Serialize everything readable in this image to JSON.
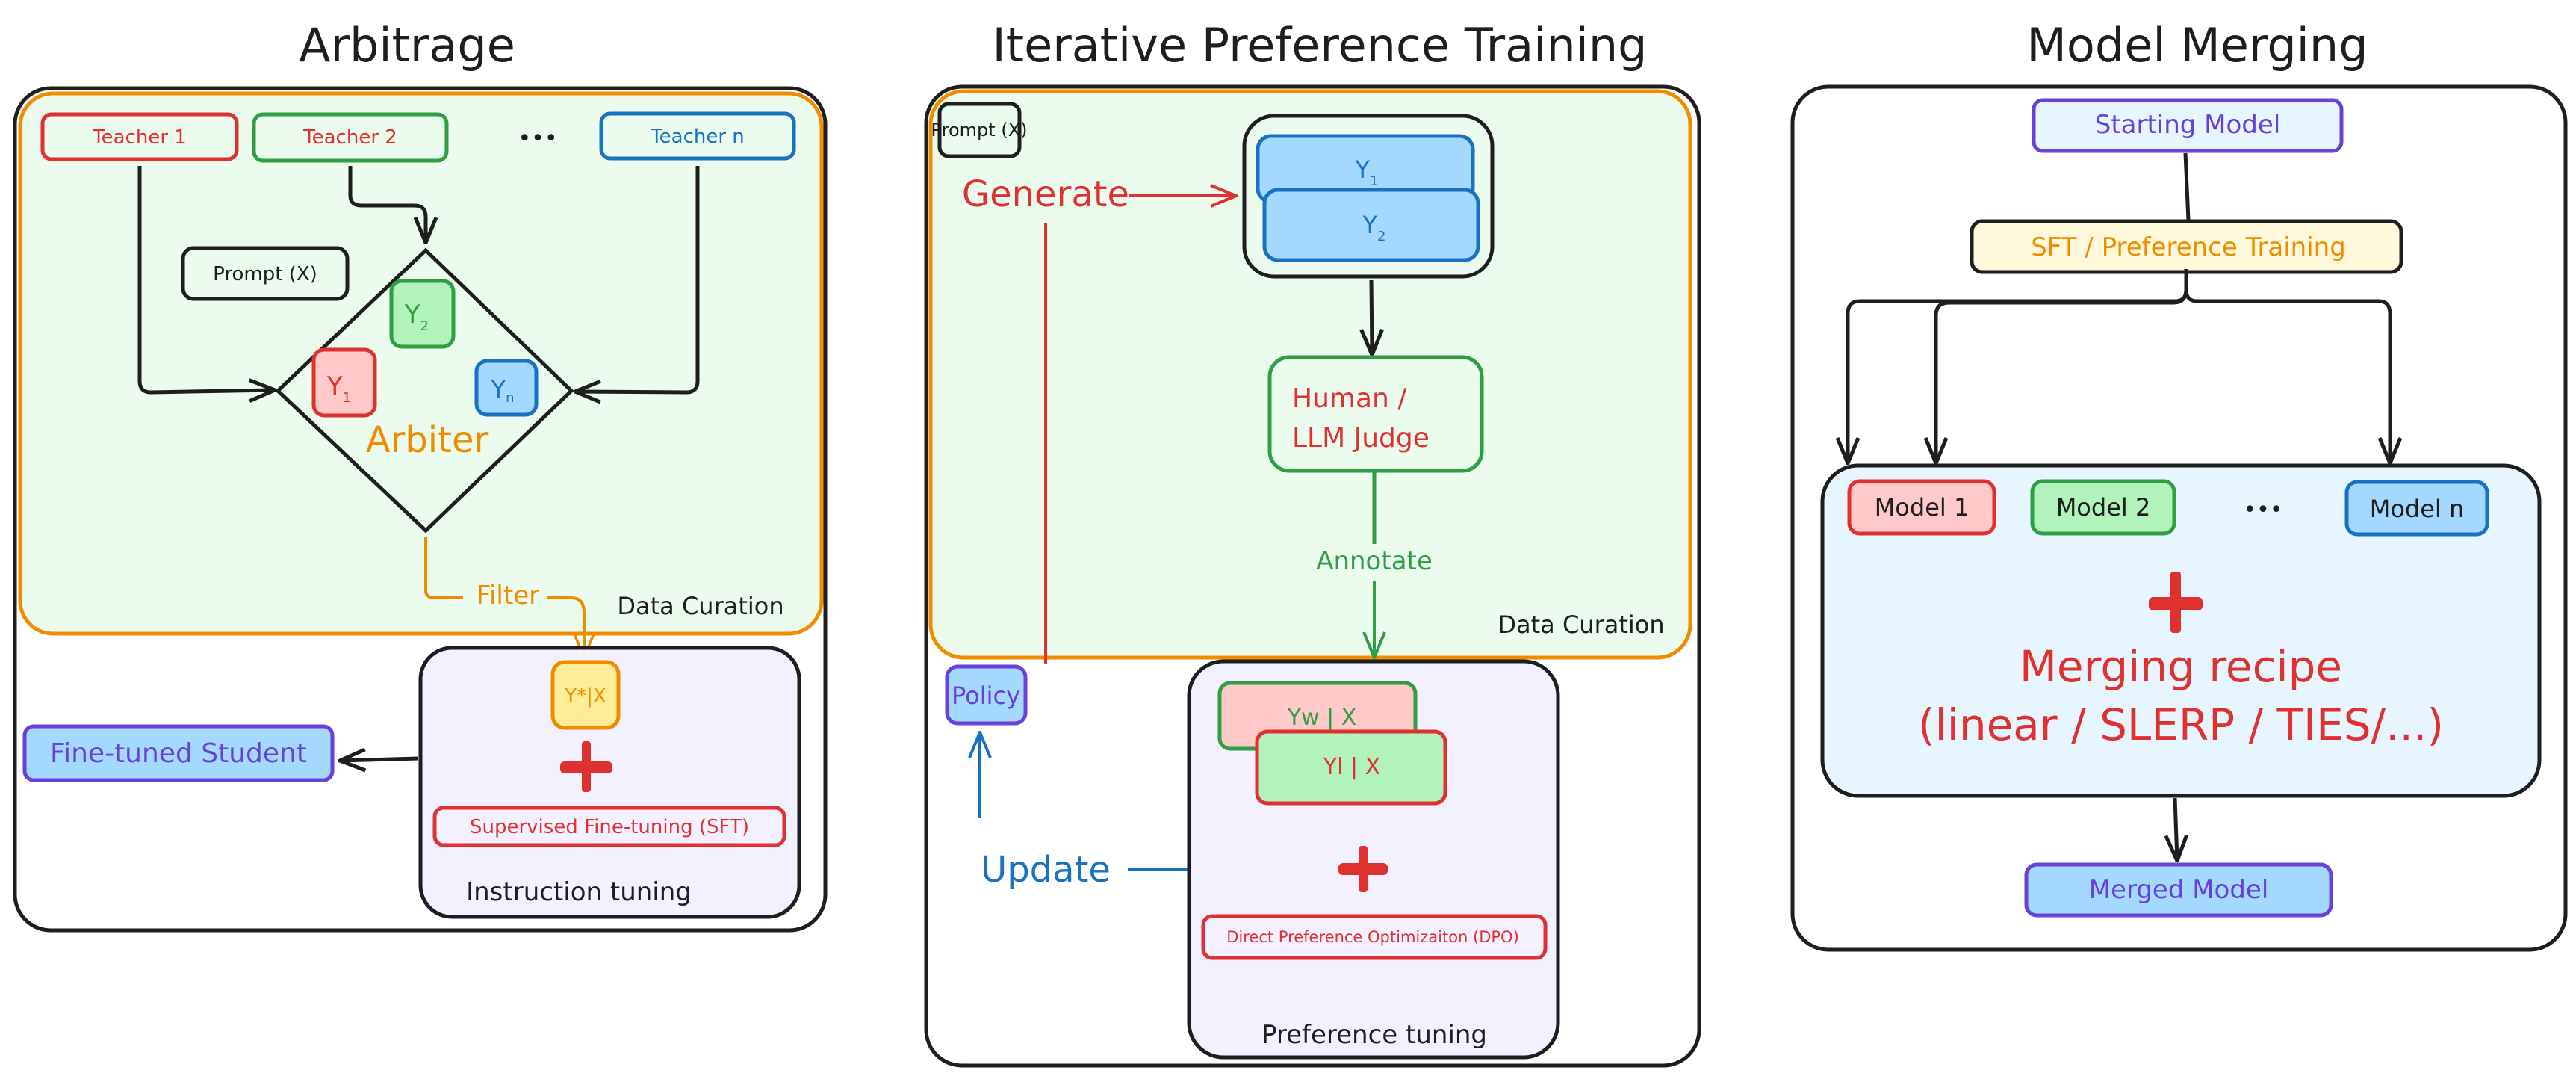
{
  "colors": {
    "ink": "#1e1e1e",
    "orange": "#f08c00",
    "red": "#e03131",
    "green": "#2f9e44",
    "blue": "#1971c2",
    "violet": "#6741d9",
    "curation_fill": "#ebfbee",
    "tuning_fill": "#f3f0ff",
    "red_fill": "#ffc9c9",
    "green_fill": "#b2f2bb",
    "blue_fill": "#a5d8ff",
    "yellow_fill": "#ffec99",
    "light_blue_fill": "#e7f5ff",
    "cream_fill": "#fff9db"
  },
  "arbitrage": {
    "title": "Arbitrage",
    "teachers": [
      {
        "label": "Teacher 1",
        "color": "#e03131"
      },
      {
        "label": "Teacher 2",
        "color": "#2f9e44",
        "text_color": "#e03131"
      },
      {
        "label": "Teacher n",
        "color": "#1971c2"
      }
    ],
    "ellipsis": "•••",
    "prompt": "Prompt (X)",
    "responses": [
      {
        "label": "Y",
        "sub": "1"
      },
      {
        "label": "Y",
        "sub": "2"
      },
      {
        "label": "Y",
        "sub": "n"
      }
    ],
    "arbiter": "Arbiter",
    "filter": "Filter",
    "data_curation": "Data Curation",
    "selected": "Y*|X",
    "plus": "+",
    "method": "Supervised Fine-tuning (SFT)",
    "stage": "Instruction tuning",
    "output": "Fine-tuned Student"
  },
  "iterative": {
    "title": "Iterative Preference Training",
    "prompt": "Prompt (X)",
    "generate": "Generate",
    "responses": [
      {
        "label": "Y",
        "sub": "1"
      },
      {
        "label": "Y",
        "sub": "2"
      }
    ],
    "judge_line1": "Human /",
    "judge_line2": "LLM Judge",
    "annotate": "Annotate",
    "data_curation": "Data Curation",
    "policy": "Policy",
    "update": "Update",
    "chosen": "Yw | X",
    "rejected": "Yl | X",
    "plus": "+",
    "method": "Direct Preference Optimizaiton (DPO)",
    "stage": "Preference tuning"
  },
  "merging": {
    "title": "Model Merging",
    "start": "Starting Model",
    "training": "SFT / Preference Training",
    "models": [
      "Model 1",
      "Model 2",
      "Model n"
    ],
    "ellipsis": "•••",
    "plus": "+",
    "recipe_line1": "Merging recipe",
    "recipe_line2": "(linear / SLERP / TIES/...)",
    "output": "Merged Model"
  }
}
